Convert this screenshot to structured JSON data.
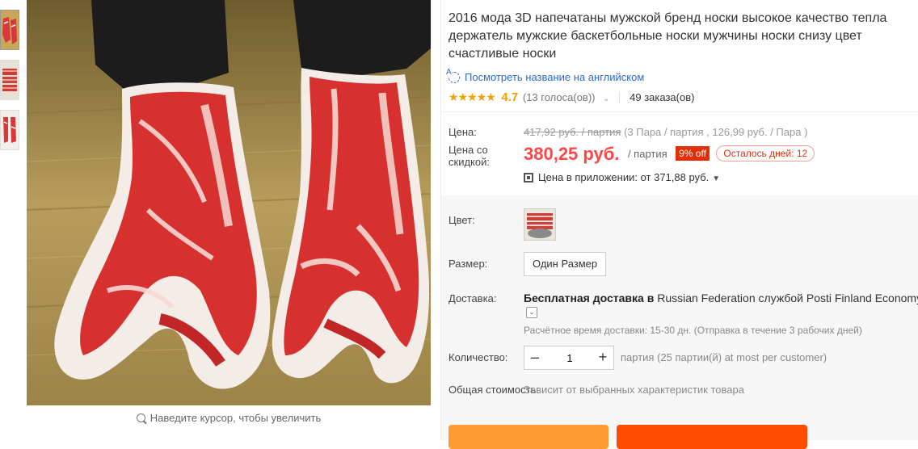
{
  "gallery": {
    "zoom_hint": "Наведите курсор, чтобы увеличить"
  },
  "product": {
    "title": "2016 мода 3D напечатаны мужской бренд носки высокое качество тепла держатель мужские баскетбольные носки мужчины носки снизу цвет счастливые носки",
    "translate_link": "Посмотреть название на английском",
    "rating": {
      "stars": "★★★★★",
      "value": "4.7",
      "votes": "(13 голоса(ов))",
      "orders": "49 заказа(ов)"
    }
  },
  "price": {
    "label": "Цена:",
    "old_price": "417,92 руб. / партия",
    "old_note": " (3 Пара / партия , 126,99 руб. / Пара )",
    "discount_label": "Цена со скидкой:",
    "current": "380,25 руб.",
    "unit": "/ партия",
    "off_badge": "9% off",
    "days_left": "Осталось дней: 12",
    "app_price": "Цена в приложении: от 371,88 руб."
  },
  "options": {
    "color_label": "Цвет:",
    "size_label": "Размер:",
    "size_value": "Один Размер",
    "shipping_label": "Доставка:",
    "shipping_bold": "Бесплатная доставка в",
    "shipping_rest": " Russian Federation службой Posti Finland Economy",
    "shipping_time": "Расчётное время доставки: 15-30 дн. (Отправка в течение 3 рабочих дней)",
    "qty_label": "Количество:",
    "qty_value": "1",
    "qty_note": "партия (25 партии(й) at most per customer)",
    "total_label": "Общая стоимость:",
    "total_note": "Зависит от выбранных характеристик товара"
  },
  "colors": {
    "price_red": "#ff4747",
    "badge_red": "#e62e04",
    "star_orange": "#f2a000",
    "link_blue": "#2a6bd4",
    "buy_orange": "#ff9c33",
    "cart_orange": "#ff4d00"
  }
}
